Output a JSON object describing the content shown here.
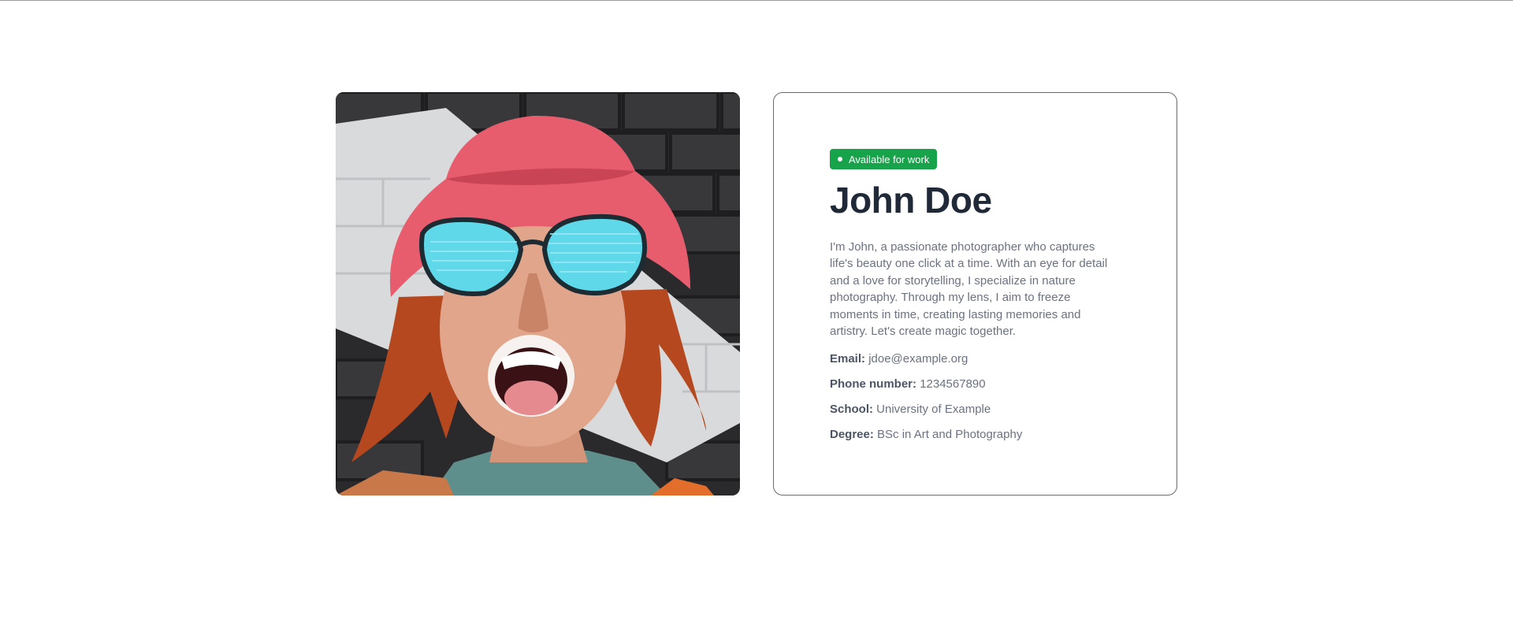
{
  "profile": {
    "status_badge": "Available for work",
    "name": "John Doe",
    "bio": "I'm John, a passionate photographer who captures life's beauty one click at a time. With an eye for detail and a love for storytelling, I specialize in nature photography. Through my lens, I aim to freeze moments in time, creating lasting memories and artistry. Let's create magic together.",
    "details": [
      {
        "label": "Email:",
        "value": "jdoe@example.org"
      },
      {
        "label": "Phone number:",
        "value": "1234567890"
      },
      {
        "label": "School:",
        "value": "University of Example"
      },
      {
        "label": "Degree:",
        "value": "BSc in Art and Photography"
      }
    ]
  },
  "colors": {
    "badge_bg": "#16a34a",
    "name_text": "#1f2937",
    "body_text": "#6b7280",
    "card_border": "#6b6b6b"
  }
}
